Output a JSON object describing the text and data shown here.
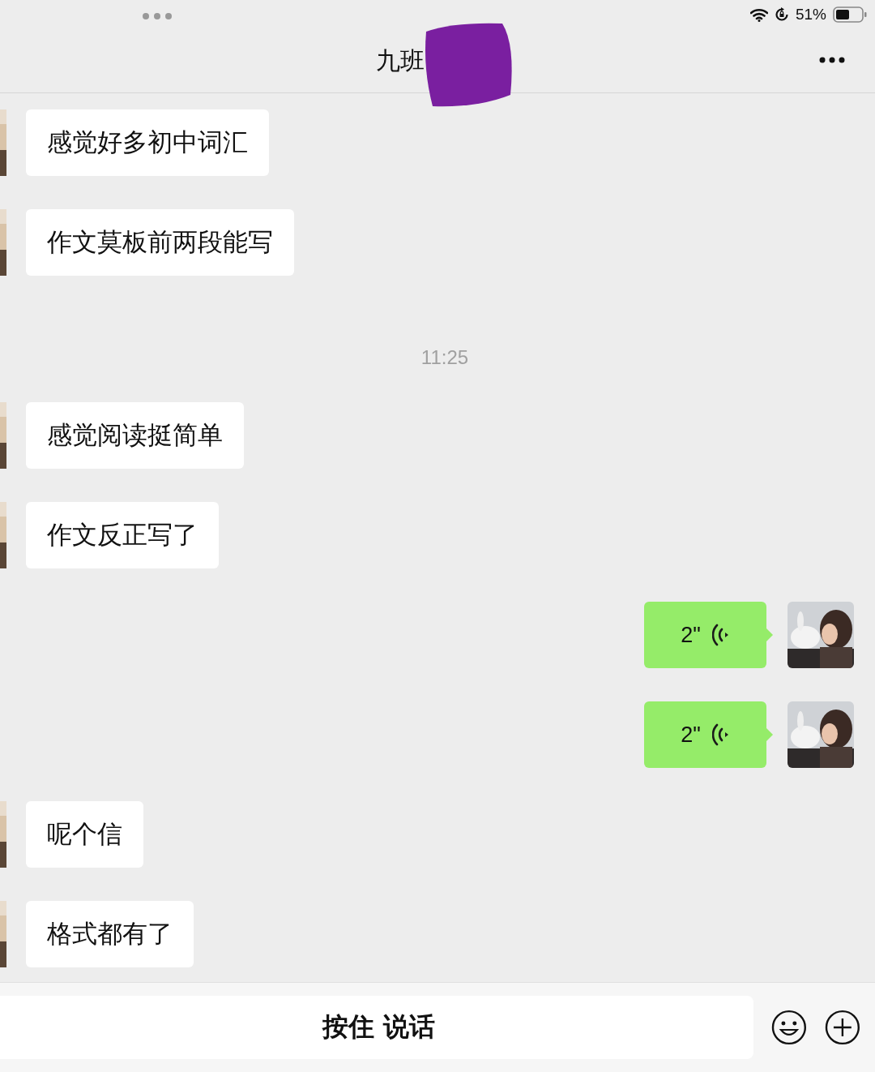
{
  "status_bar": {
    "battery": "51%"
  },
  "header": {
    "title": "九班"
  },
  "messages": [
    {
      "kind": "text",
      "text": "感觉好多初中词汇"
    },
    {
      "kind": "text",
      "text": "作文莫板前两段能写"
    },
    {
      "kind": "time",
      "text": "11:25"
    },
    {
      "kind": "text",
      "text": "感觉阅读挺简单"
    },
    {
      "kind": "text",
      "text": "作文反正写了"
    },
    {
      "kind": "voice",
      "text": "2\""
    },
    {
      "kind": "voice",
      "text": "2\""
    },
    {
      "kind": "text",
      "text": "呢个信"
    },
    {
      "kind": "text",
      "text": "格式都有了"
    }
  ],
  "input_bar": {
    "hold_to_talk": "按住 说话"
  }
}
